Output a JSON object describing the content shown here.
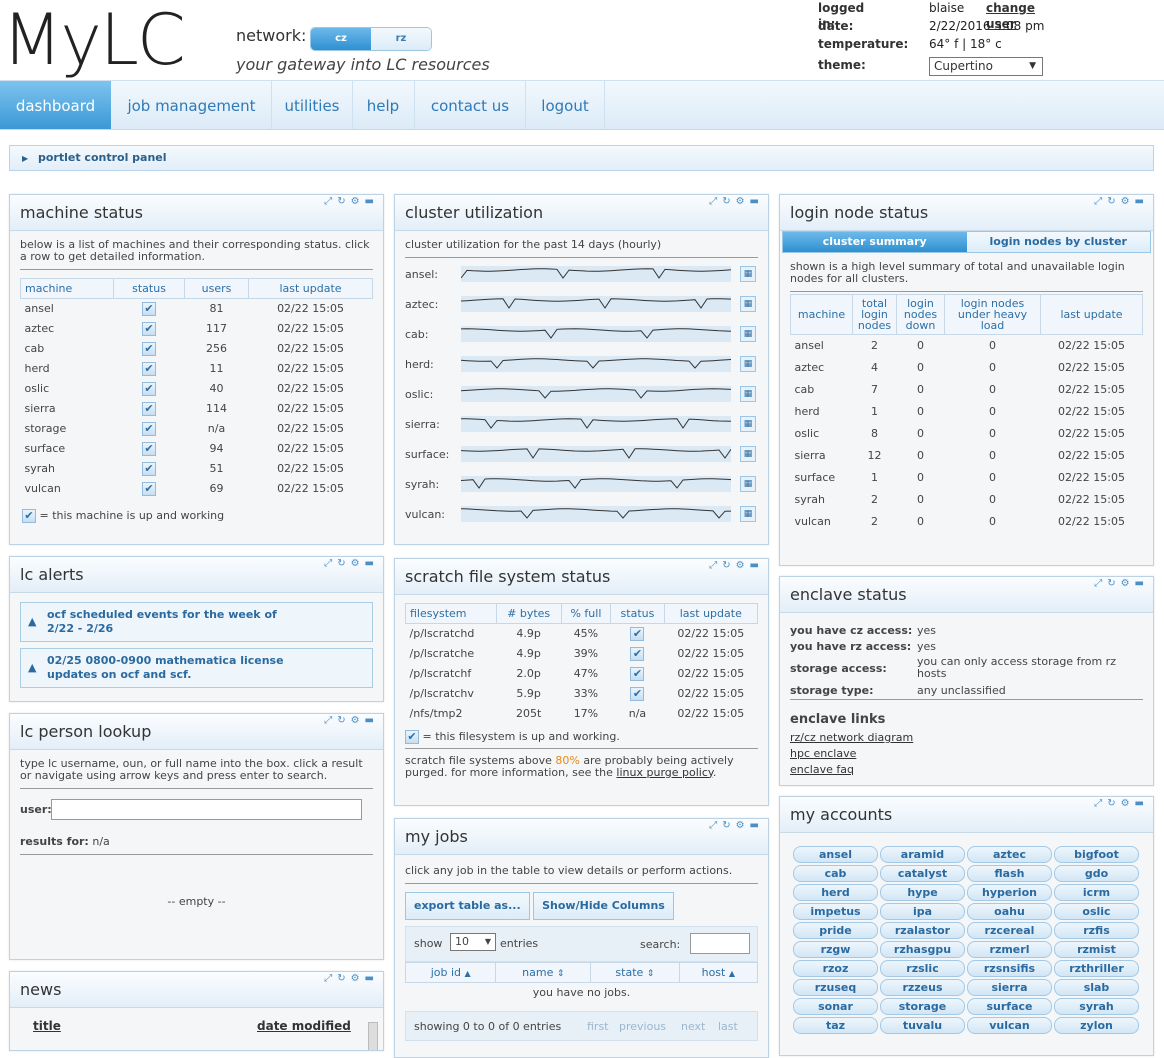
{
  "header": {
    "logo": "MyLC",
    "network_label": "network:",
    "network_options": [
      "cz",
      "rz"
    ],
    "tagline": "your gateway into LC resources",
    "logged_in_label": "logged in:",
    "user": "blaise",
    "change_user": "change user",
    "date_label": "date:",
    "date": "2/22/2016 3:08 pm",
    "temperature_label": "temperature:",
    "temperature": "64° f | 18° c",
    "theme_label": "theme:",
    "theme": "Cupertino"
  },
  "nav": [
    "dashboard",
    "job management",
    "utilities",
    "help",
    "contact us",
    "logout"
  ],
  "control_panel": "portlet control panel",
  "machine_status": {
    "title": "machine status",
    "desc": "below is a list of machines and their corresponding status. click a row to get detailed information.",
    "columns": [
      "machine",
      "status",
      "users",
      "last update"
    ],
    "rows": [
      [
        "ansel",
        "81",
        "02/22 15:05"
      ],
      [
        "aztec",
        "117",
        "02/22 15:05"
      ],
      [
        "cab",
        "256",
        "02/22 15:05"
      ],
      [
        "herd",
        "11",
        "02/22 15:05"
      ],
      [
        "oslic",
        "40",
        "02/22 15:05"
      ],
      [
        "sierra",
        "114",
        "02/22 15:05"
      ],
      [
        "storage",
        "n/a",
        "02/22 15:05"
      ],
      [
        "surface",
        "94",
        "02/22 15:05"
      ],
      [
        "syrah",
        "51",
        "02/22 15:05"
      ],
      [
        "vulcan",
        "69",
        "02/22 15:05"
      ]
    ],
    "legend": "= this machine is up and working"
  },
  "lc_alerts": {
    "title": "lc alerts",
    "items": [
      "ocf scheduled events for the week of 2/22 - 2/26",
      "02/25 0800-0900 mathematica license updates on ocf and scf."
    ]
  },
  "person_lookup": {
    "title": "lc person lookup",
    "desc": "type lc username, oun, or full name into the box. click a result or navigate using arrow keys and press enter to search.",
    "user_label": "user:",
    "results_label": "results for:",
    "results_value": "n/a",
    "empty": "-- empty --"
  },
  "news": {
    "title": "news",
    "col_title": "title",
    "col_modified": "date modified"
  },
  "cluster_util": {
    "title": "cluster utilization",
    "desc": "cluster utilization for the past 14 days (hourly)",
    "clusters": [
      "ansel:",
      "aztec:",
      "cab:",
      "herd:",
      "oslic:",
      "sierra:",
      "surface:",
      "syrah:",
      "vulcan:"
    ]
  },
  "scratch": {
    "title": "scratch file system status",
    "columns": [
      "filesystem",
      "# bytes",
      "% full",
      "status",
      "last update"
    ],
    "rows": [
      [
        "/p/lscratchd",
        "4.9p",
        "45%",
        "check",
        "02/22 15:05"
      ],
      [
        "/p/lscratche",
        "4.9p",
        "39%",
        "check",
        "02/22 15:05"
      ],
      [
        "/p/lscratchf",
        "2.0p",
        "47%",
        "check",
        "02/22 15:05"
      ],
      [
        "/p/lscratchv",
        "5.9p",
        "33%",
        "check",
        "02/22 15:05"
      ],
      [
        "/nfs/tmp2",
        "205t",
        "17%",
        "n/a",
        "02/22 15:05"
      ]
    ],
    "legend": "= this filesystem is up and working.",
    "note_pre": "scratch file systems above",
    "note_pct": "80%",
    "note_mid": "are probably being actively purged. for more information, see the",
    "note_link": "linux purge policy",
    "note_end": "."
  },
  "my_jobs": {
    "title": "my jobs",
    "desc": "click any job in the table to view details or perform actions.",
    "export_btn": "export table as...",
    "columns_btn": "Show/Hide Columns",
    "show_label": "show",
    "show_value": "10",
    "entries_label": "entries",
    "search_label": "search:",
    "columns": [
      "job id",
      "name",
      "state",
      "host"
    ],
    "empty": "you have no jobs.",
    "showing": "showing 0 to 0 of 0 entries",
    "pager": [
      "first",
      "previous",
      "next",
      "last"
    ]
  },
  "login_nodes": {
    "title": "login node status",
    "tabs": [
      "cluster summary",
      "login nodes by cluster"
    ],
    "desc": "shown is a high level summary of total and unavailable login nodes for all clusters.",
    "columns": [
      "machine",
      "total login nodes",
      "login nodes down",
      "login nodes under heavy load",
      "last update"
    ],
    "rows": [
      [
        "ansel",
        "2",
        "0",
        "0",
        "02/22 15:05"
      ],
      [
        "aztec",
        "4",
        "0",
        "0",
        "02/22 15:05"
      ],
      [
        "cab",
        "7",
        "0",
        "0",
        "02/22 15:05"
      ],
      [
        "herd",
        "1",
        "0",
        "0",
        "02/22 15:05"
      ],
      [
        "oslic",
        "8",
        "0",
        "0",
        "02/22 15:05"
      ],
      [
        "sierra",
        "12",
        "0",
        "0",
        "02/22 15:05"
      ],
      [
        "surface",
        "1",
        "0",
        "0",
        "02/22 15:05"
      ],
      [
        "syrah",
        "2",
        "0",
        "0",
        "02/22 15:05"
      ],
      [
        "vulcan",
        "2",
        "0",
        "0",
        "02/22 15:05"
      ]
    ]
  },
  "enclave": {
    "title": "enclave status",
    "cz_label": "you have cz access:",
    "cz_value": "yes",
    "rz_label": "you have rz access:",
    "rz_value": "yes",
    "storage_label": "storage access:",
    "storage_value": "you can only access storage from rz hosts",
    "type_label": "storage type:",
    "type_value": "any unclassified",
    "links_title": "enclave links",
    "links": [
      "rz/cz network diagram",
      "hpc enclave",
      "enclave faq"
    ]
  },
  "accounts": {
    "title": "my accounts",
    "items": [
      "ansel",
      "aramid",
      "aztec",
      "bigfoot",
      "cab",
      "catalyst",
      "flash",
      "gdo",
      "herd",
      "hype",
      "hyperion",
      "icrm",
      "impetus",
      "ipa",
      "oahu",
      "oslic",
      "pride",
      "rzalastor",
      "rzcereal",
      "rzfis",
      "rzgw",
      "rzhasgpu",
      "rzmerl",
      "rzmist",
      "rzoz",
      "rzslic",
      "rzsnsifis",
      "rzthriller",
      "rzuseq",
      "rzzeus",
      "sierra",
      "slab",
      "sonar",
      "storage",
      "surface",
      "syrah",
      "taz",
      "tuvalu",
      "vulcan",
      "zylon"
    ]
  }
}
